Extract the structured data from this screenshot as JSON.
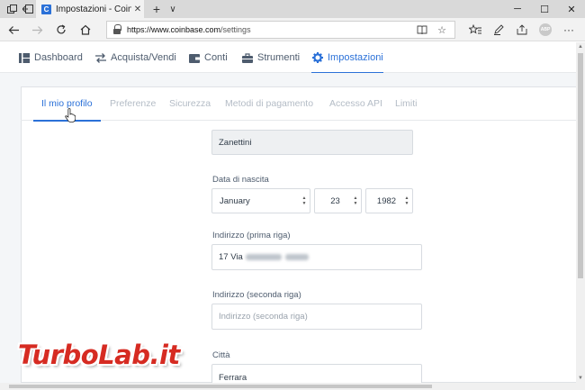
{
  "browser": {
    "tab_title": "Impostazioni - Coinbase",
    "tab_favicon_letter": "C",
    "url_domain": "https://www.coinbase.com",
    "url_path": "/settings",
    "new_tab_glyph": "+",
    "tab_menu_glyph": "∨",
    "abp_label": "ABP"
  },
  "app_nav": {
    "items": [
      {
        "label": "Dashboard",
        "icon": "dashboard-icon"
      },
      {
        "label": "Acquista/Vendi",
        "icon": "swap-arrows-icon"
      },
      {
        "label": "Conti",
        "icon": "wallet-icon"
      },
      {
        "label": "Strumenti",
        "icon": "toolbox-icon"
      },
      {
        "label": "Impostazioni",
        "icon": "gear-icon"
      }
    ],
    "active_index": 4,
    "accent_color": "#2b71d8"
  },
  "sub_tabs": {
    "items": [
      "Il mio profilo",
      "Preferenze",
      "Sicurezza",
      "Metodi di pagamento",
      "Accesso API",
      "Limiti"
    ],
    "active_index": 0
  },
  "form": {
    "last_name_value": "Zanettini",
    "birth_label": "Data di nascita",
    "birth_month": "January",
    "birth_day": "23",
    "birth_year": "1982",
    "address1_label": "Indirizzo (prima riga)",
    "address1_value_visible": "17 Via",
    "address2_label": "Indirizzo (seconda riga)",
    "address2_placeholder": "Indirizzo (seconda riga)",
    "city_label": "Città",
    "city_value": "Ferrara"
  },
  "watermark": {
    "text": "TurboLab.it"
  }
}
